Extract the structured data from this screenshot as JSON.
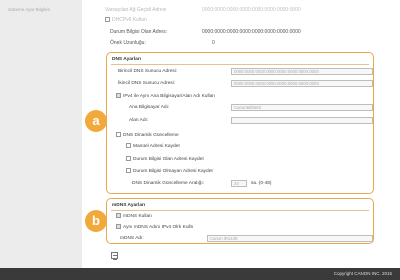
{
  "sidebar": {
    "faded_item": "Sisteme Ayar Bilgileri"
  },
  "top": {
    "row0_label": "Varsayılan Ağ Geçidi Adresi",
    "row0_value": "0000:0000:0000:0000:0000:0000:0000:0000",
    "dhcp_label": "DHCPv6 Kullan",
    "status_addr_label": "Durum Bilgisi Olan Adres:",
    "status_addr_value": "0000:0000:0000:0000:0000:0000:0000:0000",
    "prefix_label": "Önek Uzunluğu:",
    "prefix_value": "0"
  },
  "dns": {
    "title": "DNS Ayarları",
    "primary_label": "Birincil DNS Sunucu Adresi:",
    "primary_value": "0000:0000:0000:0000:0000:0000:0000:0000",
    "secondary_label": "İkincil DNS Sunucu Adresi:",
    "secondary_value": "0000:0000:0000:0000:0000:0000:0000:0000",
    "same_host_label": "IPv4 ile Aynı Ana Bilgisayar/Alan Adı Kullan",
    "host_label": "Ana Bilgisayar Adı:",
    "host_value": "Canon8db563",
    "domain_label": "Alan Adı:",
    "domain_value": "",
    "dynamic_label": "DNS Dinamik Güncelleme",
    "manual_label": "Manüel Adresi Kaydet",
    "stateful_label": "Durum Bilgisi Olan Adresi Kaydet",
    "stateless_label": "Durum Bilgisi Olmayan Adresi Kaydet",
    "interval_label": "DNS Dinamik Güncelleme Aralığı:",
    "interval_value": "24",
    "interval_unit": "sa. (0-48)"
  },
  "mdns": {
    "title": "mDNS Ayarları",
    "use_label": "mDNS Kullan",
    "same_name_label": "Aynı mDNS Adını IPv4 Olrk Kulln",
    "name_label": "mDNS Adı:",
    "name_value": "Canon iR1435"
  },
  "badges": {
    "a": "a",
    "b": "b"
  },
  "footer": {
    "copyright": "Copyright CANON INC. 2015"
  }
}
